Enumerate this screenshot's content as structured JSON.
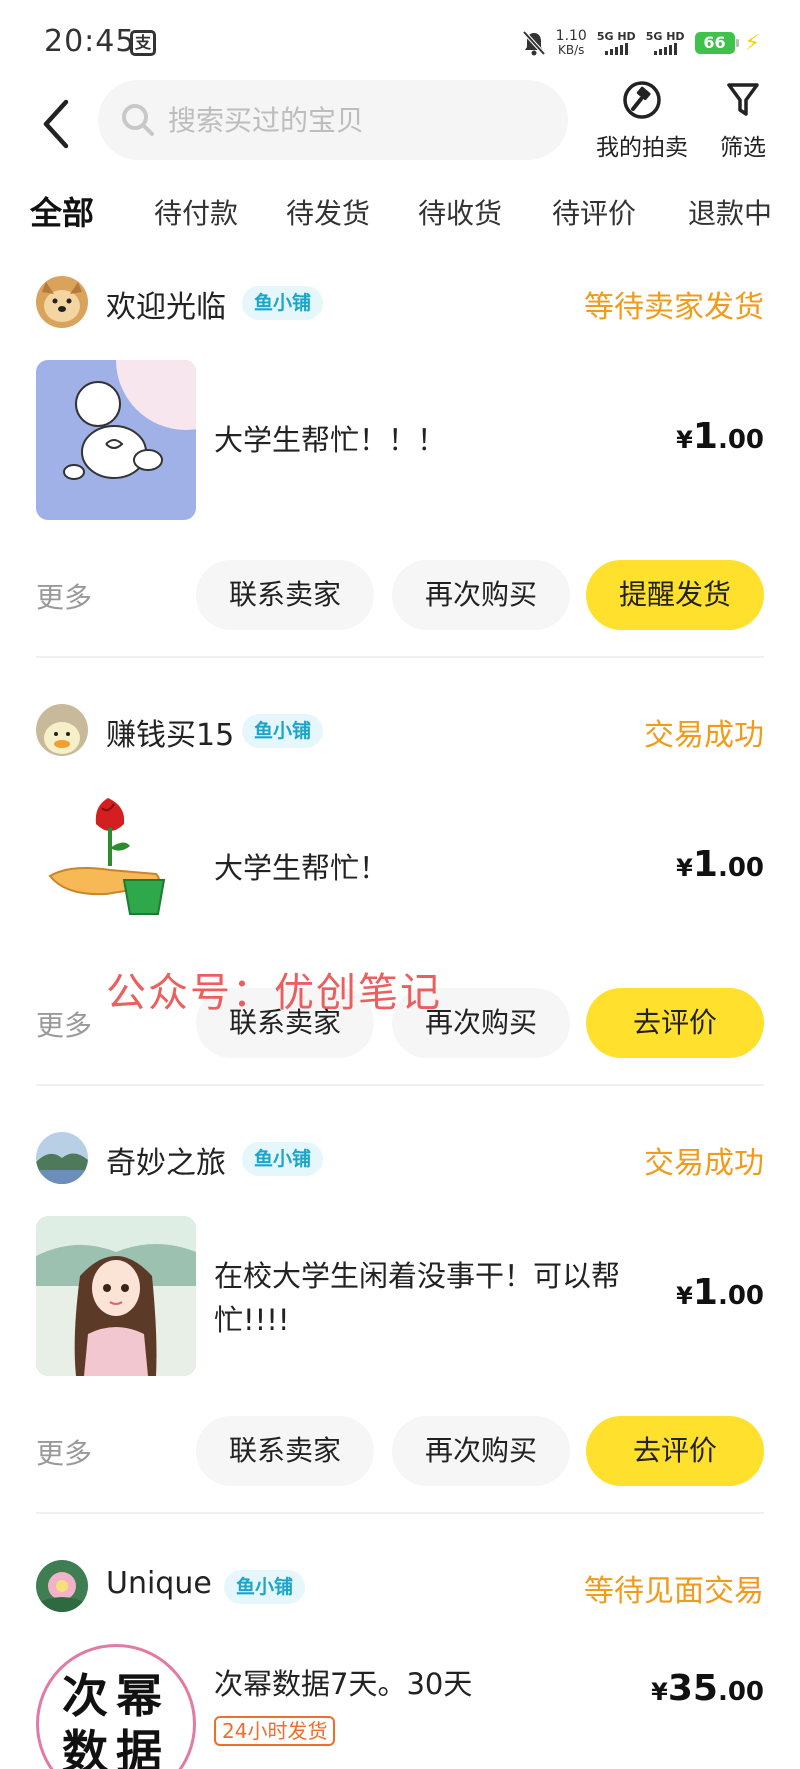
{
  "status_bar": {
    "time": "20:45",
    "notif_glyph": "支",
    "net_speed_value": "1.10",
    "net_speed_unit": "KB/s",
    "sim1": "5G HD",
    "sim2": "5G HD",
    "battery": "66"
  },
  "header": {
    "search_placeholder": "搜索买过的宝贝",
    "auction_label": "我的拍卖",
    "filter_label": "筛选"
  },
  "tabs": [
    "全部",
    "待付款",
    "待发货",
    "待收货",
    "待评价",
    "退款中"
  ],
  "orders": [
    {
      "shop": "欢迎光临",
      "badge": "鱼小铺",
      "status": "等待卖家发货",
      "title": "大学生帮忙！！！",
      "price_currency": "¥",
      "price_int": "1",
      "price_dec": ".00",
      "more": "更多",
      "btn_contact": "联系卖家",
      "btn_rebuy": "再次购买",
      "btn_primary": "提醒发货"
    },
    {
      "shop": "赚钱买15",
      "badge": "鱼小铺",
      "status": "交易成功",
      "title": "大学生帮忙！",
      "price_currency": "¥",
      "price_int": "1",
      "price_dec": ".00",
      "more": "更多",
      "btn_contact": "联系卖家",
      "btn_rebuy": "再次购买",
      "btn_primary": "去评价"
    },
    {
      "shop": "奇妙之旅",
      "badge": "鱼小铺",
      "status": "交易成功",
      "title": "在校大学生闲着没事干！可以帮忙!!!!",
      "price_currency": "¥",
      "price_int": "1",
      "price_dec": ".00",
      "more": "更多",
      "btn_contact": "联系卖家",
      "btn_rebuy": "再次购买",
      "btn_primary": "去评价"
    },
    {
      "shop": "Unique",
      "badge": "鱼小铺",
      "status": "等待见面交易",
      "title": "次幂数据7天。30天",
      "tag": "24小时发货",
      "thumb_text": "次幂数据",
      "price_currency": "¥",
      "price_int": "35",
      "price_dec": ".00"
    }
  ],
  "watermark": "公众号：优创笔记",
  "colors": {
    "accent_yellow": "#ffe12d",
    "status_orange": "#f29a1a",
    "badge_cyan": "#1ba6c9",
    "tag_orange": "#f06d2b"
  }
}
